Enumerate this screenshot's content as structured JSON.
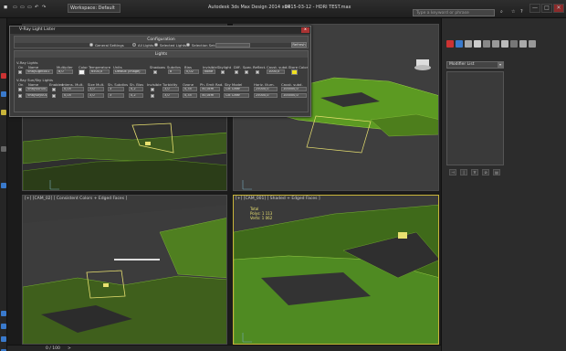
{
  "titlebar": {
    "workspace": "Workspace: Default",
    "app_title": "Autodesk 3ds Max Design 2014 x64",
    "file_title": "2015-03-12 - HDRI TEST.max",
    "search_placeholder": "Type a keyword or phrase",
    "minimize": "—",
    "maximize": "□",
    "close": "✕"
  },
  "dialog": {
    "title": "V-Ray Light Lister",
    "close": "x",
    "configuration": {
      "header": "Configuration",
      "options": [
        "General Settings",
        "All Lights",
        "Selected Lights",
        "Selection Set:"
      ],
      "selected_index": 1,
      "selection_set_value": "",
      "refresh": "Refresh"
    },
    "lights": {
      "header": "Lights",
      "vray_lights_label": "V-Ray Lights",
      "columns": [
        "On",
        "Name",
        "Multiplier",
        "Color",
        "Temperature",
        "Units",
        "Shadows",
        "Subdivs",
        "Bias",
        "Invisible",
        "Skylight",
        "Diff.",
        "Spec.",
        "Reflect.",
        "Caust. subd.",
        "Store Color"
      ],
      "row": {
        "name": "VRayLight001",
        "multiplier": "8,0",
        "temperature": "6500,0",
        "units": "Default (image)",
        "subdivs": "8",
        "bias": "0,02",
        "invisible_value": "None",
        "caust_subd": "1000,0"
      },
      "sun_label": "V-Ray Sun/Sky Lights",
      "sun_columns": [
        "On",
        "Name",
        "Enabled",
        "Intens. Mult.",
        "Size Mult.",
        "Sh. Subdivs",
        "Sh. Bias",
        "Invisible",
        "Turbidity",
        "Ozone",
        "Ph. Emit Rad.",
        "Sky Model",
        "Horiz. Illum.",
        "Caust. subd."
      ],
      "sun_rows": [
        {
          "name": "VRaySun001",
          "intens": "0,05",
          "size": "3,0",
          "subdivs": "3",
          "bias": "0,2",
          "turbidity": "3,0",
          "ozone": "0,35",
          "emit": "50,0cm",
          "model": "CIE Clear",
          "horiz": "25000,0",
          "caust": "100000,0"
        },
        {
          "name": "VRaySky001",
          "intens": "0,05",
          "size": "3,0",
          "subdivs": "3",
          "bias": "0,2",
          "turbidity": "3,0",
          "ozone": "0,35",
          "emit": "50,0cm",
          "model": "CIE Clear",
          "horiz": "25000,0",
          "caust": "100000,0"
        }
      ]
    }
  },
  "viewports": {
    "top_left_label": "",
    "top_right_label": "",
    "bottom_left_label": "[+] [CAM_02] [ Consistent Colors + Edged Faces ]",
    "bottom_right_label": "[+] [CAM_001] [ Shaded + Edged Faces ]",
    "stats": {
      "line1": "Total",
      "line2": "Polys: 1 113",
      "line3": "Verts: 1 062"
    }
  },
  "command_panel": {
    "modifier_list": "Modifier List",
    "stack_buttons": [
      "⊣",
      "|",
      "∀",
      "⊘",
      "▤"
    ]
  },
  "bottombar": {
    "frame_counter": "0 / 100",
    "arrow": ">"
  },
  "colors": {
    "accent": "#c8b43a",
    "mesh": "#7bbf2e",
    "gizmo": "#e8e070",
    "background": "#1b1b1b"
  }
}
